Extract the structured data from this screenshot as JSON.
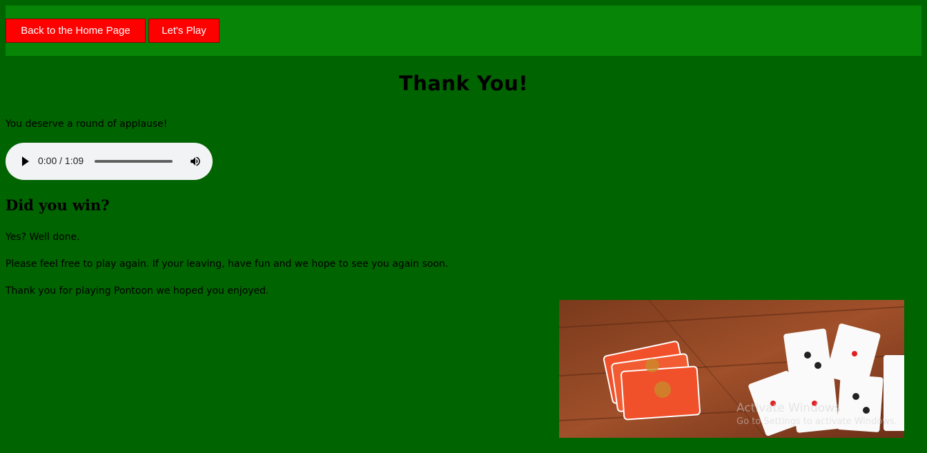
{
  "nav": {
    "home_label": "Back to the Home Page",
    "play_label": "Let's Play"
  },
  "main": {
    "title": "Thank You!",
    "applause_text": "You deserve a round of applause!",
    "audio": {
      "time_display": "0:00 / 1:09"
    },
    "question_heading": "Did you win?",
    "yes_text": "Yes? Well done.",
    "play_again_text": "Please feel free to play again. If your leaving, have fun and we hope to see you again soon.",
    "thanks_text": "Thank you for playing Pontoon we hoped you enjoyed."
  },
  "watermark": {
    "title": "Activate Windows",
    "subtitle": "Go to Settings to activate Windows."
  },
  "colors": {
    "page_background": "#006400",
    "navbar_background": "#078507",
    "button_background": "#ff0000",
    "button_text": "#ffffff"
  },
  "icons": {
    "play": "play-icon",
    "volume": "volume-icon"
  }
}
